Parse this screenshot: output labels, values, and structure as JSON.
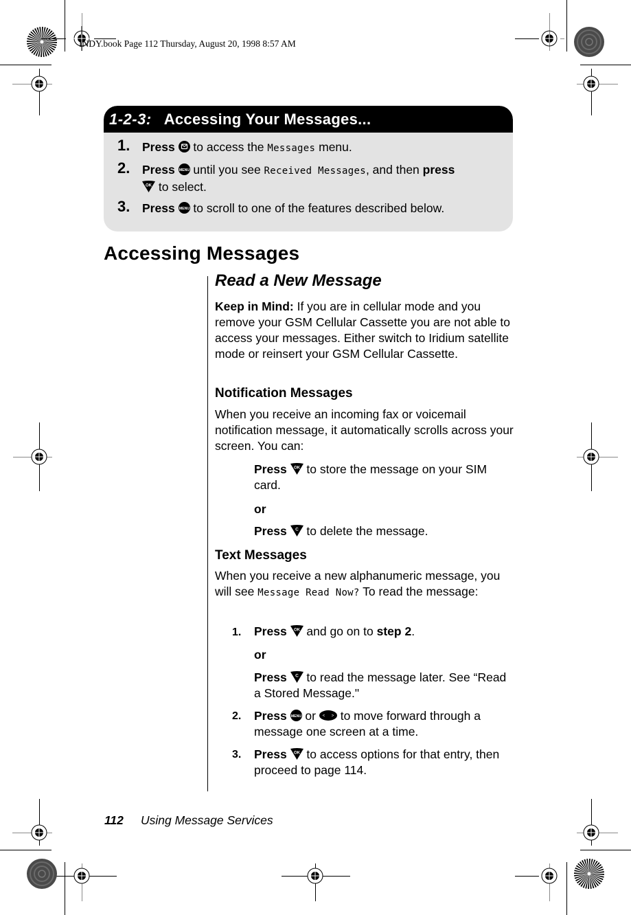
{
  "slug": "INDY.book  Page 112  Thursday, August 20, 1998  8:57 AM",
  "quick_box": {
    "number": "1-2-3:",
    "title": "Accessing Your Messages...",
    "steps": [
      {
        "num": "1.",
        "press": "Press",
        "icon": "message-key-icon",
        "before_lcd": " to access the ",
        "lcd": "Messages",
        "after_lcd": " menu."
      },
      {
        "num": "2.",
        "press": "Press",
        "icon": "menu-key-icon",
        "before_lcd": "  until you see ",
        "lcd": "Received Messages",
        "after_lcd": ", and then ",
        "press2": "press",
        "icon2": "ok-key-icon",
        "tail": "  to select."
      },
      {
        "num": "3.",
        "press": "Press",
        "icon": "menu-key-icon",
        "text": "  to scroll to one of the features described below."
      }
    ]
  },
  "section_title": "Accessing Messages",
  "subsection_title": "Read a New Message",
  "keep_in_mind": {
    "label": "Keep in Mind:",
    "text": " If you are in cellular mode and you remove your GSM Cellular Cassette you are not able to access your messages. Either switch to Iridium satellite mode or reinsert your GSM Cellular Cassette."
  },
  "notification": {
    "title": "Notification Messages",
    "body": "When you receive an incoming fax or voicemail notification message, it automatically scrolls across your screen. You can:",
    "option1": {
      "press": "Press",
      "icon": "ok-key-icon",
      "text": " to store the message on your SIM card."
    },
    "or": "or",
    "option2": {
      "press": "Press",
      "icon": "c-key-icon",
      "text": " to delete the message."
    }
  },
  "text_messages": {
    "title": "Text Messages",
    "body_before": "When you receive a new alphanumeric message, you will see ",
    "lcd": "Message Read Now?",
    "body_after": " To read the message:",
    "steps": [
      {
        "num": "1.",
        "press": "Press",
        "icon": "ok-key-icon",
        "text": " and go on to ",
        "bold_tail": "step 2",
        "end": "."
      },
      {
        "or": "or"
      },
      {
        "press": "Press",
        "icon": "c-key-icon",
        "text": " to read the message later. See “Read a Stored Message.\""
      },
      {
        "num": "2.",
        "press": "Press",
        "icon": "menu-key-icon",
        "mid": "  or ",
        "icon2": "scroll-key-icon",
        "text": " to move forward through a message one screen at a time."
      },
      {
        "num": "3.",
        "press": "Press",
        "icon": "ok-key-icon",
        "text": " to access options for that entry, then proceed to page 114."
      }
    ]
  },
  "footer": {
    "page_number": "112",
    "section": "Using Message Services"
  }
}
